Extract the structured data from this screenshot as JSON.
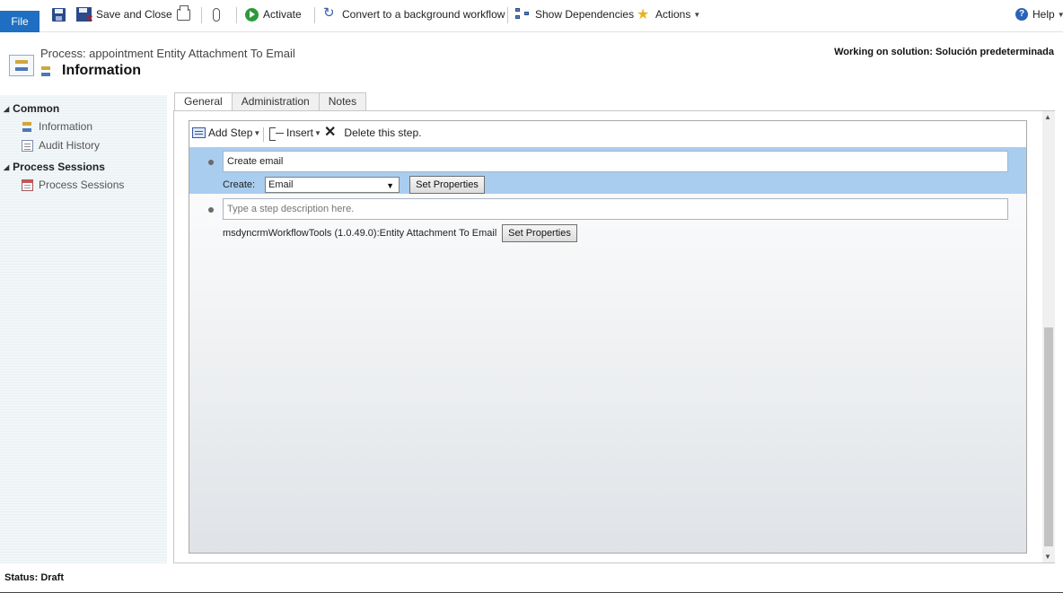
{
  "ribbon": {
    "file": "File",
    "save_and_close": "Save and Close",
    "activate": "Activate",
    "convert": "Convert to a background workflow",
    "show_dependencies": "Show Dependencies",
    "actions": "Actions",
    "help": "Help"
  },
  "header": {
    "subtitle": "Process: appointment Entity Attachment To Email",
    "title": "Information",
    "solution": "Working on solution: Solución predeterminada"
  },
  "nav": {
    "groups": [
      {
        "label": "Common",
        "items": [
          {
            "label": "Information",
            "icon": "process-icon"
          },
          {
            "label": "Audit History",
            "icon": "audit-icon"
          }
        ]
      },
      {
        "label": "Process Sessions",
        "items": [
          {
            "label": "Process Sessions",
            "icon": "sessions-icon"
          }
        ]
      }
    ]
  },
  "tabs": [
    {
      "label": "General",
      "active": true
    },
    {
      "label": "Administration",
      "active": false
    },
    {
      "label": "Notes",
      "active": false
    }
  ],
  "designer": {
    "toolbar": {
      "add_step": "Add Step",
      "insert": "Insert",
      "delete": "Delete this step."
    },
    "steps": [
      {
        "description": "Create email",
        "create_label": "Create:",
        "create_value": "Email",
        "button": "Set Properties"
      },
      {
        "description": "",
        "placeholder": "Type a step description here.",
        "activity": "msdyncrmWorkflowTools (1.0.49.0):Entity Attachment To Email",
        "button": "Set Properties"
      }
    ]
  },
  "status": {
    "text": "Status: Draft"
  },
  "colors": {
    "file_button": "#1e6fc1",
    "selected_step": "#a9cdef"
  }
}
